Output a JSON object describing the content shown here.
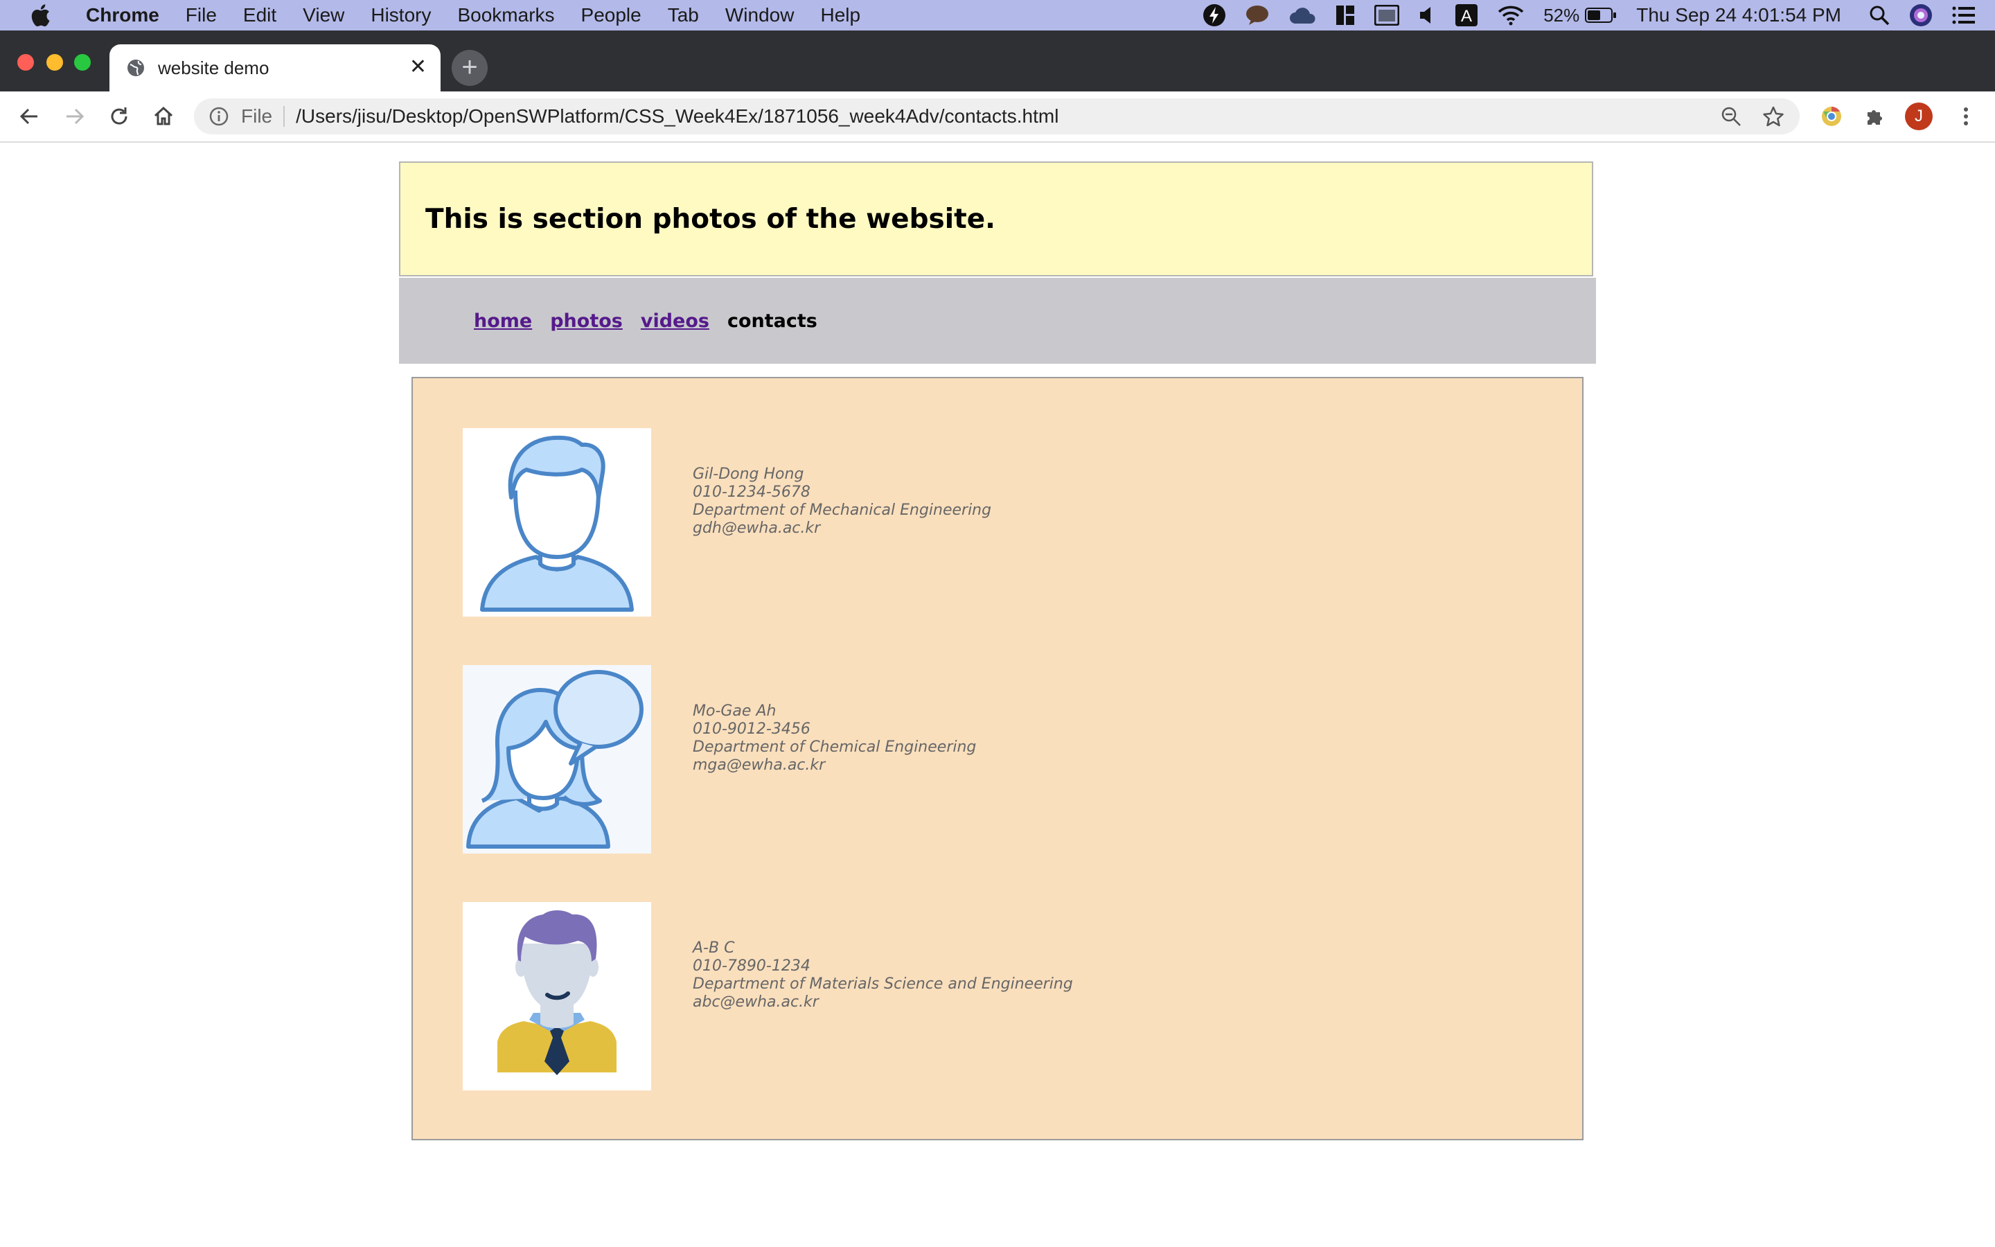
{
  "menubar": {
    "app_name": "Chrome",
    "items": [
      "File",
      "Edit",
      "View",
      "History",
      "Bookmarks",
      "People",
      "Tab",
      "Window",
      "Help"
    ],
    "battery": "52%",
    "clock": "Thu Sep 24  4:01:54 PM"
  },
  "browser": {
    "tab_title": "website demo",
    "url_scheme": "File",
    "url": "/Users/jisu/Desktop/OpenSWPlatform/CSS_Week4Ex/1871056_week4Adv/contacts.html",
    "profile_initial": "J"
  },
  "page": {
    "header_title": "This is section photos of the website.",
    "nav": [
      {
        "label": "home"
      },
      {
        "label": "photos"
      },
      {
        "label": "videos"
      },
      {
        "label": "contacts"
      }
    ],
    "contacts": [
      {
        "name": "Gil-Dong Hong",
        "phone": "010-1234-5678",
        "department": "Department of Mechanical Engineering",
        "email": "gdh@ewha.ac.kr",
        "photo_icon": "male-user-icon"
      },
      {
        "name": "Mo-Gae Ah",
        "phone": "010-9012-3456",
        "department": "Department of Chemical Engineering",
        "email": "mga@ewha.ac.kr",
        "photo_icon": "female-user-chat-icon"
      },
      {
        "name": "A-B C",
        "phone": "010-7890-1234",
        "department": "Department of Materials Science and Engineering",
        "email": "abc@ewha.ac.kr",
        "photo_icon": "businessman-icon"
      }
    ]
  },
  "colors": {
    "header_bg": "#fffac2",
    "nav_bg": "#c9c9cd",
    "contacts_bg": "#fadfbd",
    "link_visited": "#551a8b",
    "avatar_blue": "#bcdcfb",
    "avatar_stroke": "#4a86c8"
  }
}
